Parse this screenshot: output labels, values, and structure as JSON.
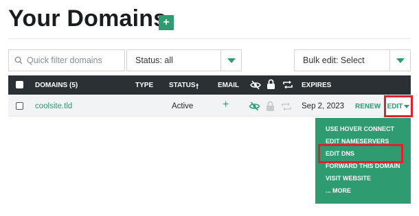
{
  "page": {
    "title": "Your Domains",
    "add_label": "+"
  },
  "filters": {
    "search_placeholder": "Quick filter domains",
    "status": "Status: all",
    "bulk": "Bulk edit: Select"
  },
  "table": {
    "headers": {
      "domains": "DOMAINS (5)",
      "type": "TYPE",
      "status": "STATUS",
      "status_sort": "🠕",
      "email": "EMAIL",
      "expires": "EXPIRES"
    },
    "row": {
      "domain": "coolsite.tld",
      "status": "Active",
      "email_add": "+",
      "expires": "Sep 2, 2023",
      "renew": "RENEW",
      "edit": "EDIT"
    }
  },
  "menu": {
    "items": [
      "USE HOVER CONNECT",
      "EDIT NAMESERVERS",
      "EDIT DNS",
      "FORWARD THIS DOMAIN",
      "VISIT WEBSITE",
      "... MORE"
    ]
  },
  "colors": {
    "accent": "#2e9b70",
    "header_bg": "#2b3034",
    "highlight": "#e0202a"
  }
}
